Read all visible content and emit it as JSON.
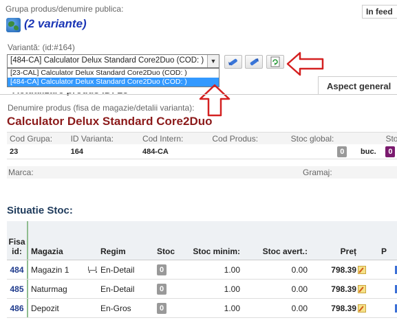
{
  "header": {
    "group_label": "Grupa produs/denumire publica:",
    "variants_title": "(2 variante)",
    "infeed_tab": "In feed"
  },
  "variant": {
    "label": "Variantă: (id:#164)",
    "selected": "[484-CA] Calculator Delux Standard Core2Duo (COD: )",
    "options": [
      "[23-CAL] Calculator Delux Standard Core2Duo (COD: )",
      "[484-CA] Calculator Delux Standard Core2Duo (COD: )"
    ],
    "selected_index": 1
  },
  "tabs": {
    "aspect_general": "Aspect general",
    "hidden_heading": "Actualizare produs ID: 23"
  },
  "product": {
    "name_label": "Denumire produs (fisa de magazie/detalii varianta):",
    "name": "Calculator Delux Standard Core2Duo",
    "info_headers": [
      "Cod Grupa:",
      "ID Varianta:",
      "Cod Intern:",
      "Cod Produs:",
      "Stoc global:",
      "Stoc"
    ],
    "info_values": {
      "cod_grupa": "23",
      "id_varianta": "164",
      "cod_intern": "484-CA",
      "cod_produs": "",
      "stoc_global": "0",
      "unit": "buc.",
      "stoc": "0"
    },
    "marca_label": "Marca:",
    "gramaj_label": "Gramaj:"
  },
  "stock": {
    "title": "Situatie Stoc:",
    "headers": {
      "fisa": "Fisa",
      "id": "id:",
      "magazia": "Magazia",
      "regim": "Regim",
      "stoc": "Stoc",
      "stoc_minim": "Stoc minim:",
      "stoc_avert": "Stoc avert.:",
      "pret": "Preț",
      "p": "P"
    },
    "rows": [
      {
        "id": "484",
        "magazia": "Magazin 1",
        "cart": true,
        "regim": "En-Detail",
        "stoc": "0",
        "stoc_minim": "1.00",
        "stoc_avert": "0.00",
        "pret": "798.39"
      },
      {
        "id": "485",
        "magazia": "Naturmag",
        "cart": false,
        "regim": "En-Detail",
        "stoc": "0",
        "stoc_minim": "1.00",
        "stoc_avert": "0.00",
        "pret": "798.39"
      },
      {
        "id": "486",
        "magazia": "Depozit",
        "cart": false,
        "regim": "En-Gros",
        "stoc": "0",
        "stoc_minim": "1.00",
        "stoc_avert": "0.00",
        "pret": "798.39"
      }
    ]
  },
  "colors": {
    "title_blue": "#1a35b5",
    "product_red": "#8b1a1a",
    "arrow_red": "#d42020",
    "select_highlight": "#3399ff",
    "purple_badge": "#7a1a6e"
  },
  "icons": {
    "globe": "globe-icon",
    "prev": "nav-prev-icon",
    "next": "nav-next-icon",
    "refresh": "refresh-icon",
    "cart": "cart-icon",
    "edit": "edit-icon",
    "sort": "sort-az-icon"
  }
}
